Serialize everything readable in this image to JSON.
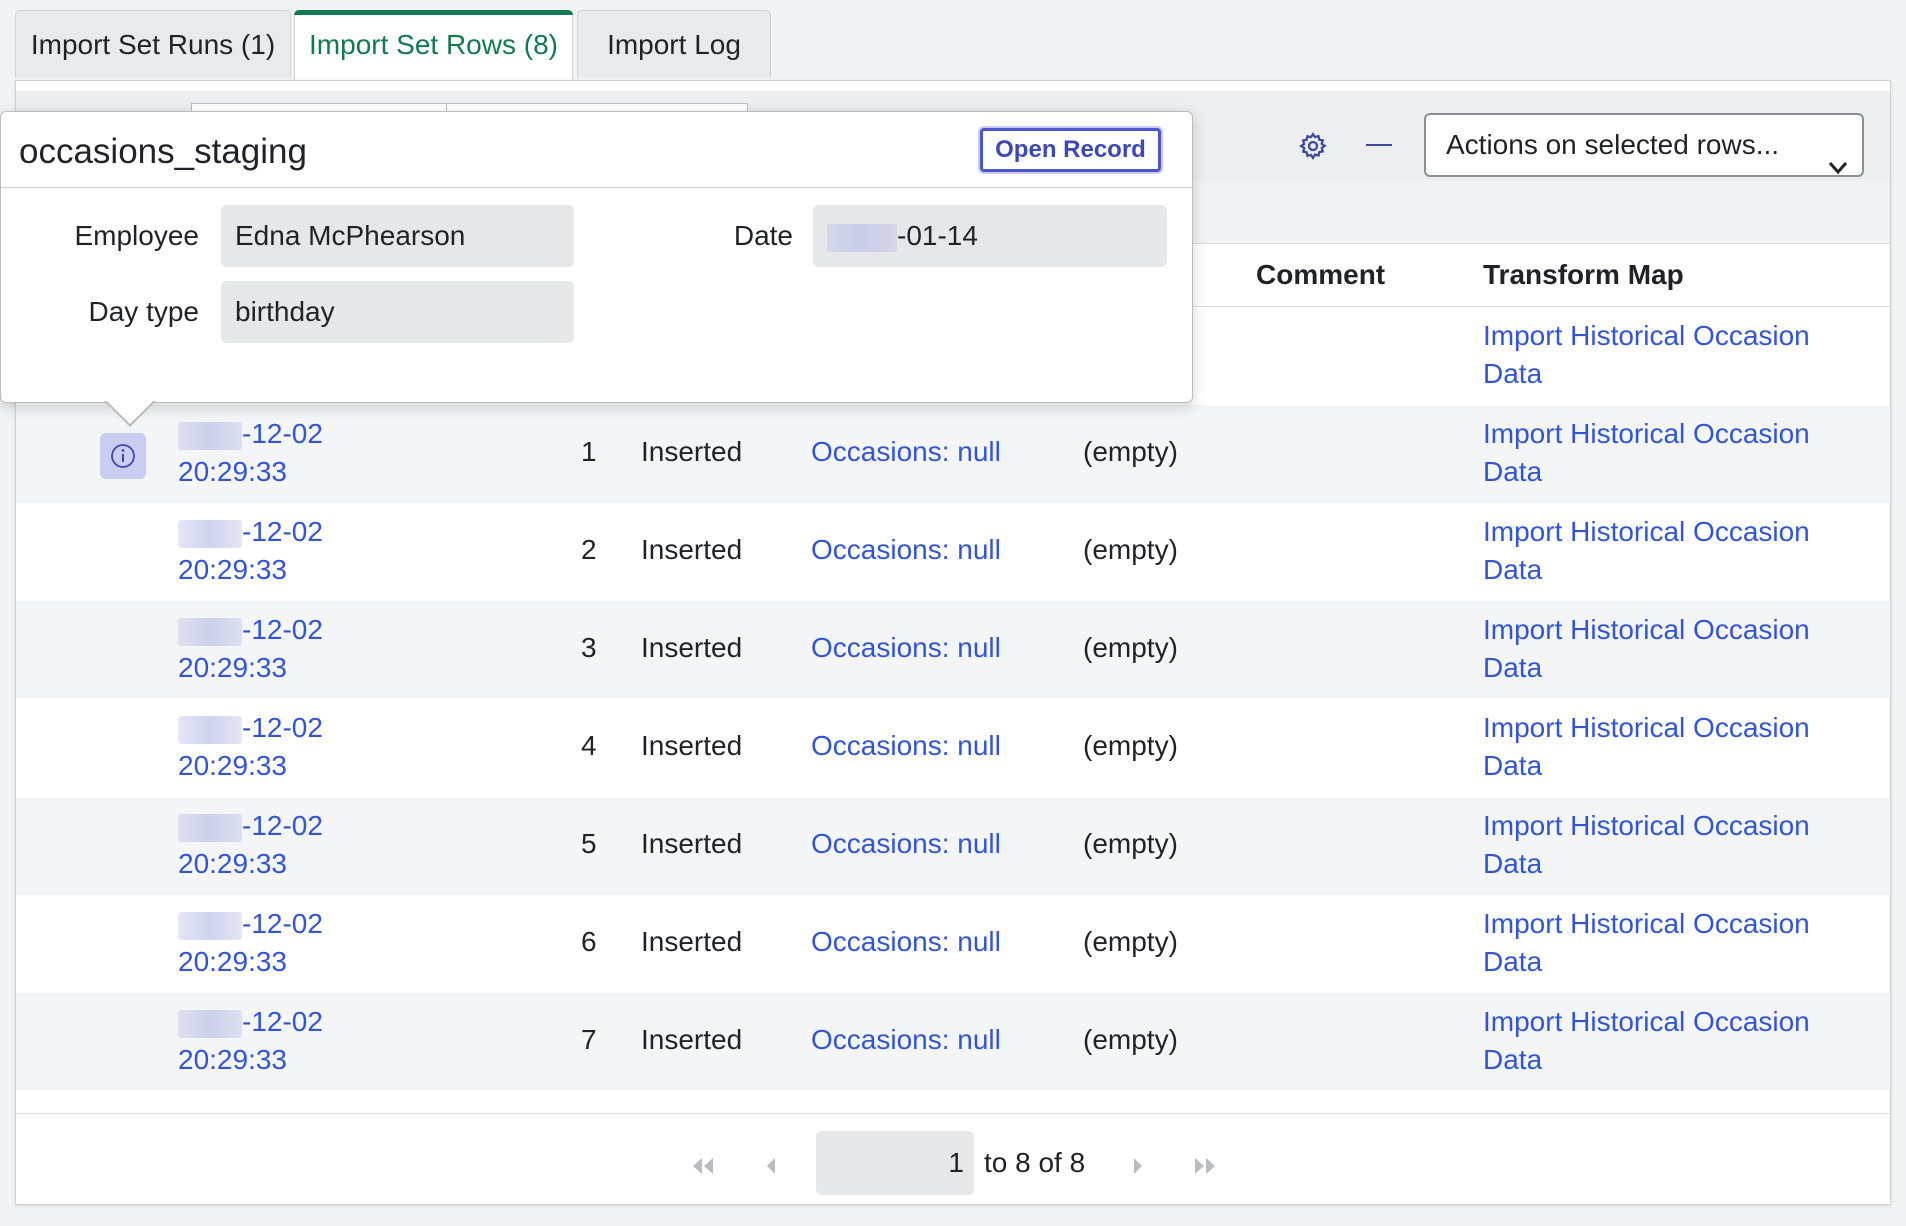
{
  "tabs": [
    {
      "label": "Import Set Runs (1)"
    },
    {
      "label": "Import Set Rows (8)"
    },
    {
      "label": "Import Log"
    }
  ],
  "toolbar": {
    "actions_label": "Actions on selected rows...",
    "icons": [
      "gear-icon",
      "minimize-icon",
      "chevron-down-icon"
    ]
  },
  "table": {
    "headers": {
      "comment": "Comment",
      "transform_map": "Transform Map"
    },
    "first_row_transform_map": [
      "Import Historical Occasion",
      "Data"
    ],
    "rows": [
      {
        "date": "-12-02",
        "time": "20:29:33",
        "num": "1",
        "state": "Inserted",
        "target": "Occasions: null",
        "comment": "(empty)",
        "map1": "Import Historical Occasion",
        "map2": "Data"
      },
      {
        "date": "-12-02",
        "time": "20:29:33",
        "num": "2",
        "state": "Inserted",
        "target": "Occasions: null",
        "comment": "(empty)",
        "map1": "Import Historical Occasion",
        "map2": "Data"
      },
      {
        "date": "-12-02",
        "time": "20:29:33",
        "num": "3",
        "state": "Inserted",
        "target": "Occasions: null",
        "comment": "(empty)",
        "map1": "Import Historical Occasion",
        "map2": "Data"
      },
      {
        "date": "-12-02",
        "time": "20:29:33",
        "num": "4",
        "state": "Inserted",
        "target": "Occasions: null",
        "comment": "(empty)",
        "map1": "Import Historical Occasion",
        "map2": "Data"
      },
      {
        "date": "-12-02",
        "time": "20:29:33",
        "num": "5",
        "state": "Inserted",
        "target": "Occasions: null",
        "comment": "(empty)",
        "map1": "Import Historical Occasion",
        "map2": "Data"
      },
      {
        "date": "-12-02",
        "time": "20:29:33",
        "num": "6",
        "state": "Inserted",
        "target": "Occasions: null",
        "comment": "(empty)",
        "map1": "Import Historical Occasion",
        "map2": "Data"
      },
      {
        "date": "-12-02",
        "time": "20:29:33",
        "num": "7",
        "state": "Inserted",
        "target": "Occasions: null",
        "comment": "(empty)",
        "map1": "Import Historical Occasion",
        "map2": "Data"
      }
    ]
  },
  "pager": {
    "current": "1",
    "range": "to 8 of 8"
  },
  "popup": {
    "title": "occasions_staging",
    "open_record": "Open Record",
    "fields": {
      "employee_label": "Employee",
      "employee_value": "Edna McPhearson",
      "daytype_label": "Day type",
      "daytype_value": "birthday",
      "date_label": "Date",
      "date_value": "-01-14"
    }
  },
  "colors": {
    "accent_green": "#127a4f",
    "link_blue": "#3155d6",
    "button_indigo": "#4b56c8"
  }
}
